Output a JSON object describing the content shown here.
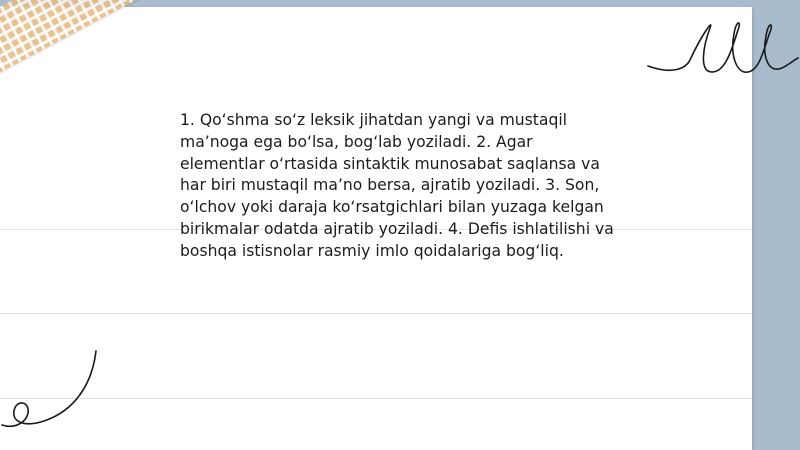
{
  "document": {
    "paragraph": "1. Qo‘shma so‘z leksik jihatdan yangi va mustaqil ma’noga ega bo‘lsa, bog‘lab yoziladi. 2. Agar elementlar o‘rtasida sintaktik munosabat saqlansa va har biri mustaqil ma’no bersa, ajratib yoziladi. 3. Son, o‘lchov yoki daraja ko‘rsatgichlari bilan yuzaga kelgan birikmalar odatda ajratib yoziladi. 4. Defis ishlatilishi va boshqa istisnolar rasmiy imlo qoidalariga bog‘liq."
  },
  "colors": {
    "background": "#a9bccd",
    "paper": "#ffffff",
    "tape": "#e4bb86",
    "ink": "#1c1c1c"
  }
}
